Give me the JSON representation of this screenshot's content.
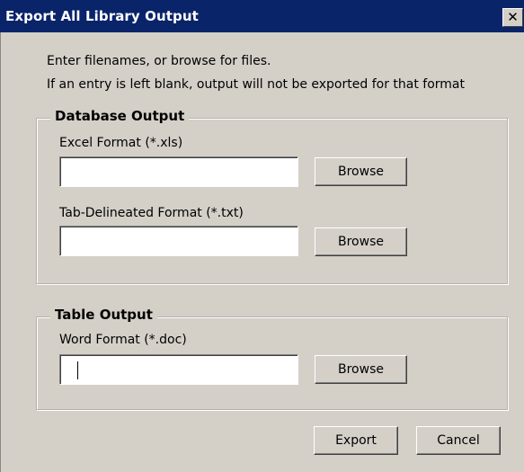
{
  "window": {
    "title": "Export All Library Output",
    "close_glyph": "✕"
  },
  "instructions": {
    "line1": "Enter filenames, or browse for files.",
    "line2": "If an entry is left blank, output will not be exported for that format"
  },
  "database_output": {
    "legend": "Database Output",
    "excel": {
      "label": "Excel Format (*.xls)",
      "value": "",
      "browse_label": "Browse"
    },
    "tab": {
      "label": "Tab-Delineated Format (*.txt)",
      "value": "",
      "browse_label": "Browse"
    }
  },
  "table_output": {
    "legend": "Table Output",
    "word": {
      "label": "Word Format (*.doc)",
      "value": "",
      "browse_label": "Browse"
    }
  },
  "footer": {
    "export_label": "Export",
    "cancel_label": "Cancel"
  }
}
